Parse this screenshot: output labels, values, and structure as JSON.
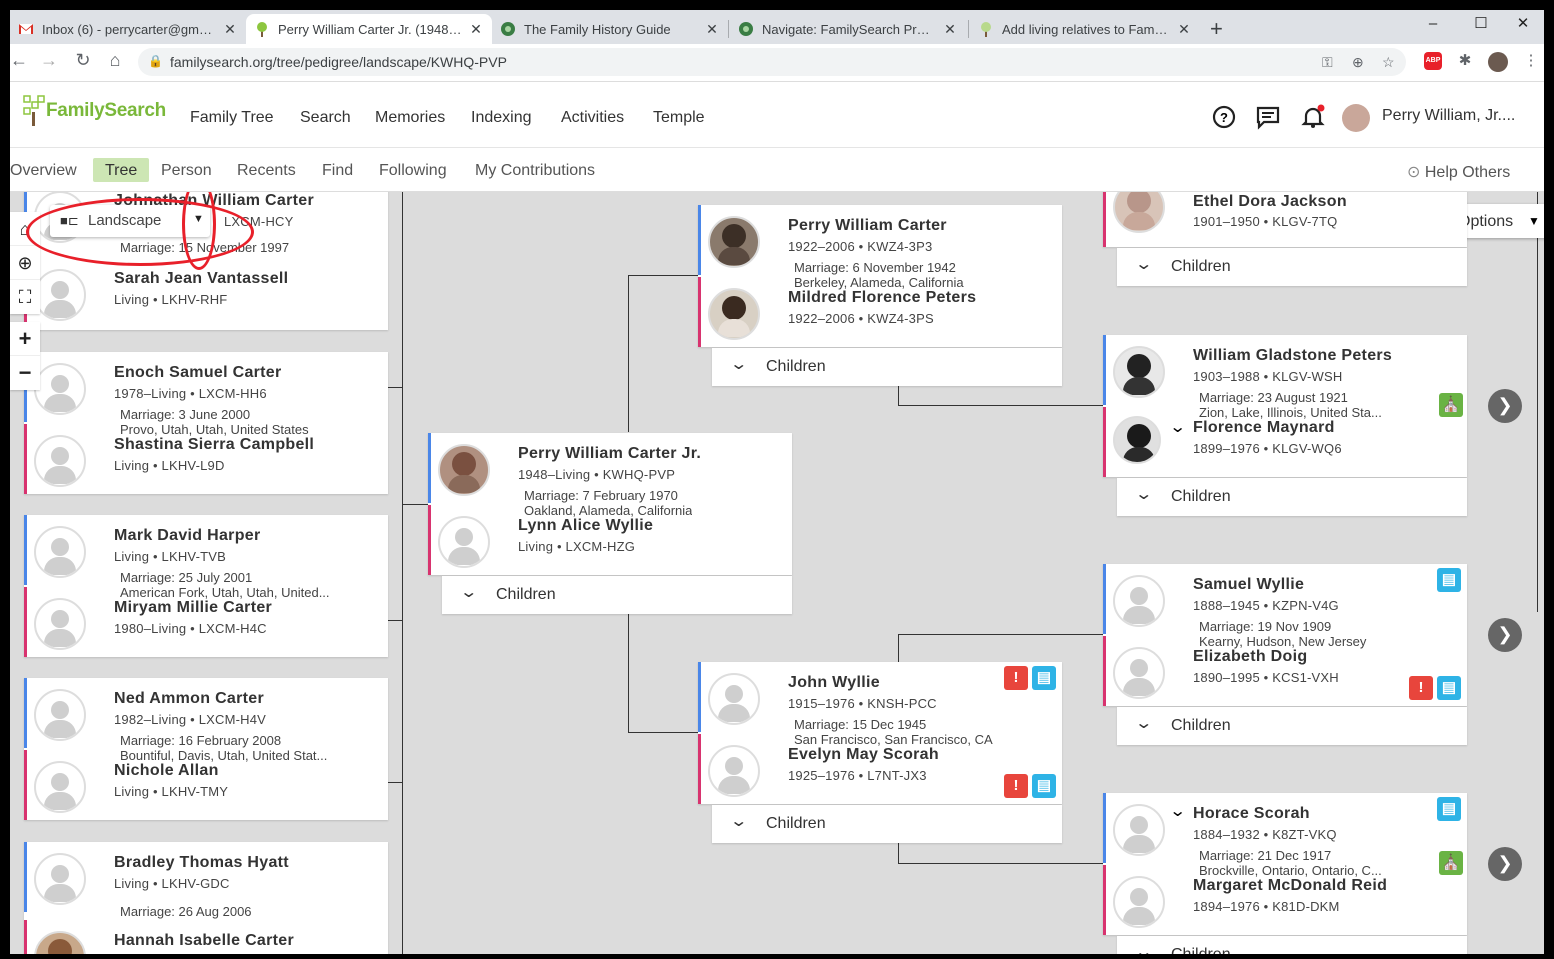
{
  "browser": {
    "tabs": [
      {
        "title": "Inbox (6) - perrycarter@gmail.com",
        "icon": "gmail-icon"
      },
      {
        "title": "Perry William Carter Jr. (1948–Living)",
        "icon": "familysearch-tree-icon"
      },
      {
        "title": "The Family History Guide",
        "icon": "family-history-guide-icon"
      },
      {
        "title": "Navigate: FamilySearch Project 1",
        "icon": "family-history-guide-icon"
      },
      {
        "title": "Add living relatives to Family Tree",
        "icon": "familysearch-tree-icon"
      }
    ],
    "new_tab": "+",
    "window_controls": {
      "minimize": "–",
      "maximize": "☐",
      "close": "✕"
    },
    "url": "familysearch.org/tree/pedigree/landscape/KWHQ-PVP",
    "nav": {
      "back": "←",
      "forward": "→",
      "reload": "↻",
      "home": "⌂"
    },
    "ext_abp": "ABP"
  },
  "header": {
    "logo_text": "FamilySearch",
    "nav": [
      "Family Tree",
      "Search",
      "Memories",
      "Indexing",
      "Activities",
      "Temple"
    ],
    "user_name": "Perry William, Jr...."
  },
  "subnav": {
    "items": [
      "Overview",
      "Tree",
      "Person",
      "Recents",
      "Find",
      "Following",
      "My Contributions"
    ],
    "active": "Tree",
    "help_others": "Help Others"
  },
  "controls": {
    "view_mode": "Landscape",
    "options_label": "Options",
    "tools": [
      "home-icon",
      "locate-icon",
      "fullscreen-icon",
      "zoom-in-icon",
      "zoom-out-icon"
    ]
  },
  "children_label": "Children",
  "left_cards": [
    {
      "husband": {
        "name": "Johnathan William Carter",
        "meta": "LXCM-HCY"
      },
      "marriage": [
        "Marriage: 15 November 1997"
      ],
      "wife": {
        "name": "Sarah Jean Vantassell",
        "meta": "Living • LKHV-RHF"
      }
    },
    {
      "husband": {
        "name": "Enoch Samuel Carter",
        "meta": "1978–Living • LXCM-HH6"
      },
      "marriage": [
        "Marriage: 3 June 2000",
        "Provo, Utah, Utah, United States"
      ],
      "wife": {
        "name": "Shastina Sierra Campbell",
        "meta": "Living • LKHV-L9D"
      }
    },
    {
      "husband": {
        "name": "Mark David Harper",
        "meta": "Living • LKHV-TVB"
      },
      "marriage": [
        "Marriage: 25 July 2001",
        "American Fork, Utah, Utah, United..."
      ],
      "wife": {
        "name": "Miryam Millie Carter",
        "meta": "1980–Living • LXCM-H4C"
      }
    },
    {
      "husband": {
        "name": "Ned Ammon Carter",
        "meta": "1982–Living • LXCM-H4V"
      },
      "marriage": [
        "Marriage: 16 February 2008",
        "Bountiful, Davis, Utah, United Stat..."
      ],
      "wife": {
        "name": "Nichole Allan",
        "meta": "Living • LKHV-TMY"
      }
    },
    {
      "husband": {
        "name": "Bradley Thomas Hyatt",
        "meta": "Living • LKHV-GDC"
      },
      "marriage": [
        "Marriage: 26 Aug 2006"
      ],
      "wife": {
        "name": "Hannah Isabelle Carter",
        "meta": ""
      }
    }
  ],
  "focus_card": {
    "husband": {
      "name": "Perry William Carter Jr.",
      "meta": "1948–Living • KWHQ-PVP"
    },
    "marriage": [
      "Marriage: 7 February 1970",
      "Oakland, Alameda, California"
    ],
    "wife": {
      "name": "Lynn Alice Wyllie",
      "meta": "Living • LXCM-HZG"
    }
  },
  "parent_cards": [
    {
      "husband": {
        "name": "Perry William Carter",
        "meta": "1922–2006 • KWZ4-3P3"
      },
      "marriage": [
        "Marriage: 6 November 1942",
        "Berkeley, Alameda, California"
      ],
      "wife": {
        "name": "Mildred Florence Peters",
        "meta": "1922–2006 • KWZ4-3PS"
      }
    },
    {
      "husband": {
        "name": "John Wyllie",
        "meta": "1915–1976 • KNSH-PCC"
      },
      "marriage": [
        "Marriage: 15 Dec 1945",
        "San Francisco, San Francisco, CA"
      ],
      "wife": {
        "name": "Evelyn May Scorah",
        "meta": "1925–1976 • L7NT-JX3"
      }
    }
  ],
  "grand_cards": [
    {
      "wife": {
        "name": "Ethel Dora Jackson",
        "meta": "1901–1950 • KLGV-7TQ"
      }
    },
    {
      "husband": {
        "name": "William Gladstone Peters",
        "meta": "1903–1988 • KLGV-WSH"
      },
      "marriage": [
        "Marriage: 23 August 1921",
        "Zion, Lake, Illinois, United Sta..."
      ],
      "wife": {
        "name": "Florence Maynard",
        "meta": "1899–1976 • KLGV-WQ6"
      }
    },
    {
      "husband": {
        "name": "Samuel Wyllie",
        "meta": "1888–1945 • KZPN-V4G"
      },
      "marriage": [
        "Marriage: 19 Nov 1909",
        "Kearny, Hudson, New Jersey"
      ],
      "wife": {
        "name": "Elizabeth Doig",
        "meta": "1890–1995 • KCS1-VXH"
      }
    },
    {
      "husband": {
        "name": "Horace Scorah",
        "meta": "1884–1932 • K8ZT-VKQ"
      },
      "marriage": [
        "Marriage: 21 Dec 1917",
        "Brockville, Ontario, Ontario, C..."
      ],
      "wife": {
        "name": "Margaret McDonald Reid",
        "meta": "1894–1976 • K81D-DKM"
      }
    }
  ],
  "colors": {
    "male": "#4a86e8",
    "female": "#d8336f",
    "brand_green": "#7ab83a",
    "alert_red": "#e8453c",
    "record_blue": "#2eb3e6",
    "temple_green": "#6ab344"
  }
}
